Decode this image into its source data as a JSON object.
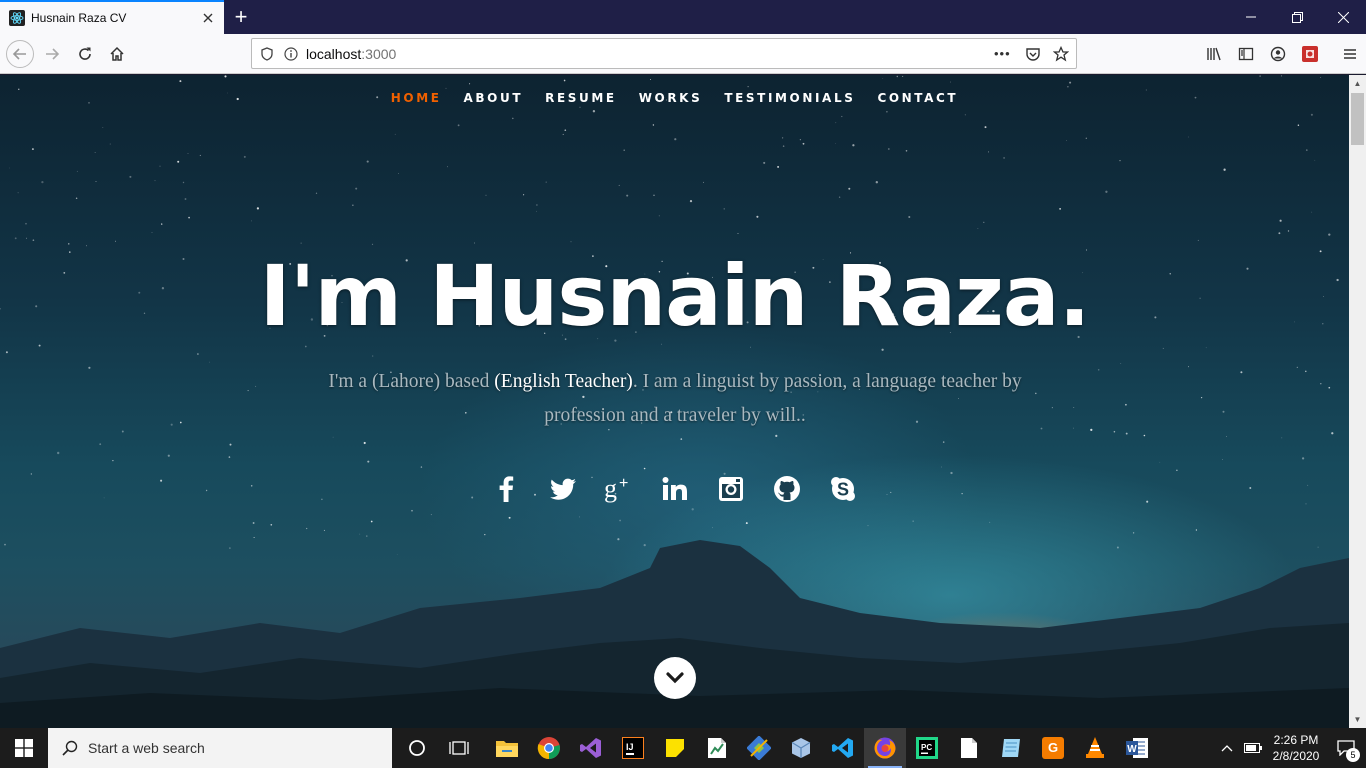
{
  "browser": {
    "tab_title": "Husnain Raza CV",
    "new_tab": "+",
    "url_host": "localhost",
    "url_port": ":3000",
    "url_more": "•••"
  },
  "site": {
    "nav": [
      {
        "label": "HOME",
        "active": true
      },
      {
        "label": "ABOUT",
        "active": false
      },
      {
        "label": "RESUME",
        "active": false
      },
      {
        "label": "WORKS",
        "active": false
      },
      {
        "label": "TESTIMONIALS",
        "active": false
      },
      {
        "label": "CONTACT",
        "active": false
      }
    ],
    "headline": "I'm Husnain Raza.",
    "intro_prefix": "I'm a (Lahore) based ",
    "intro_highlight": "(English Teacher)",
    "intro_suffix": ". I am a linguist by passion, a language teacher by profession and a traveler by will..",
    "social": [
      "facebook-icon",
      "twitter-icon",
      "google-plus-icon",
      "linkedin-icon",
      "instagram-icon",
      "github-icon",
      "skype-icon"
    ],
    "accent_color": "#F06000"
  },
  "taskbar": {
    "search_placeholder": "Start a web search",
    "time": "2:26 PM",
    "date": "2/8/2020",
    "notification_count": "5"
  }
}
